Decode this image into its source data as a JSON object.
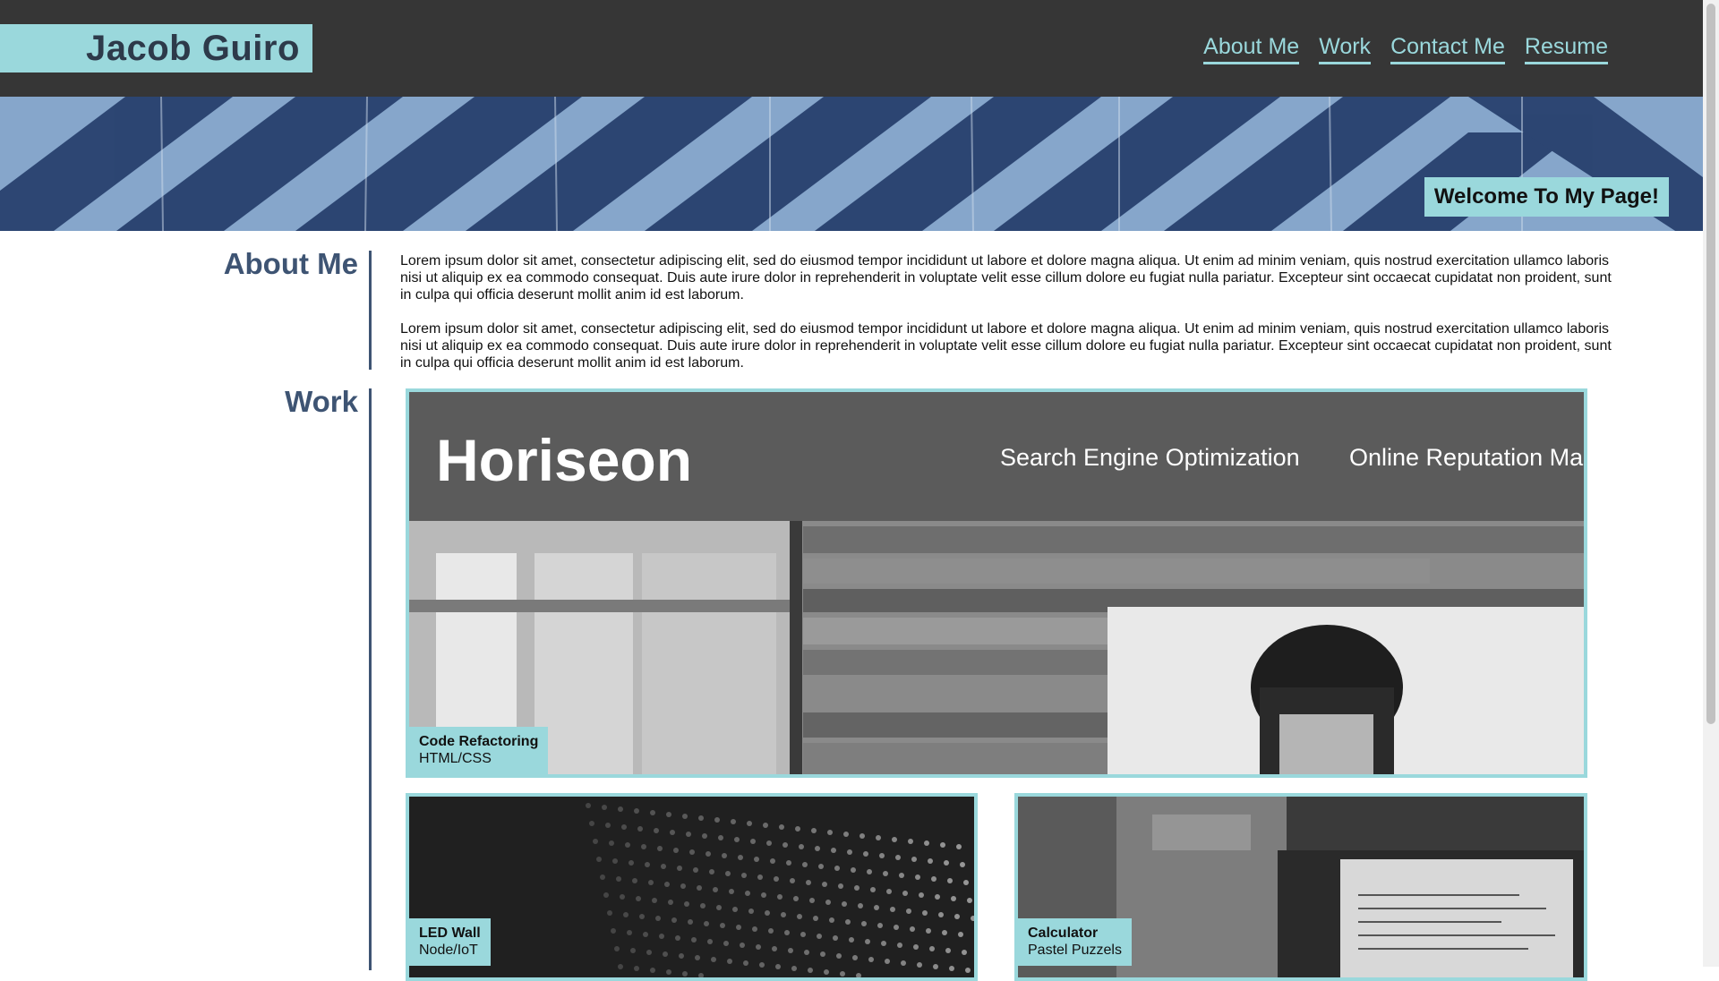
{
  "header": {
    "name": "Jacob Guiro",
    "nav": [
      "About Me",
      "Work",
      "Contact Me",
      "Resume"
    ]
  },
  "hero": {
    "badge": "Welcome To My Page!"
  },
  "about": {
    "title": "About Me",
    "paragraphs": [
      "Lorem ipsum dolor sit amet, consectetur adipiscing elit, sed do eiusmod tempor incididunt ut labore et dolore magna aliqua. Ut enim ad minim veniam, quis nostrud exercitation ullamco laboris nisi ut aliquip ex ea commodo consequat. Duis aute irure dolor in reprehenderit in voluptate velit esse cillum dolore eu fugiat nulla pariatur. Excepteur sint occaecat cupidatat non proident, sunt in culpa qui officia deserunt mollit anim id est laborum.",
      "Lorem ipsum dolor sit amet, consectetur adipiscing elit, sed do eiusmod tempor incididunt ut labore et dolore magna aliqua. Ut enim ad minim veniam, quis nostrud exercitation ullamco laboris nisi ut aliquip ex ea commodo consequat. Duis aute irure dolor in reprehenderit in voluptate velit esse cillum dolore eu fugiat nulla pariatur. Excepteur sint occaecat cupidatat non proident, sunt in culpa qui officia deserunt mollit anim id est laborum."
    ]
  },
  "work": {
    "title": "Work",
    "projects": [
      {
        "title": "Code Refactoring",
        "subtitle": "HTML/CSS",
        "screenshot": {
          "logo": "Horiseon",
          "nav": [
            "Search Engine Optimization",
            "Online Reputation Ma"
          ]
        }
      },
      {
        "title": "LED Wall",
        "subtitle": "Node/IoT"
      },
      {
        "title": "Calculator",
        "subtitle": "Pastel Puzzels"
      }
    ]
  },
  "colors": {
    "accent": "#9ad8dc",
    "header_bg": "#363636",
    "heading": "#3e5473",
    "hero_blue": "#7f9fc4",
    "hero_stripe": "#28406e"
  }
}
